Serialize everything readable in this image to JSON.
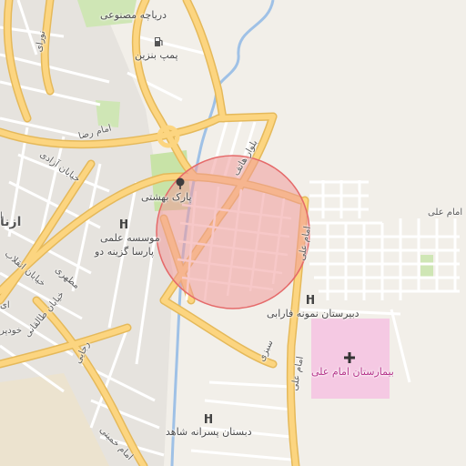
{
  "map": {
    "labels": {
      "lake": "دریاچه مصنوعی",
      "gas_station": "پمپ بنزین",
      "park": "پارک بهشتی",
      "street_hatef": "بلوار هاتف",
      "street_imam_reza": "امام رضا",
      "street_azadi": "خیابان آزادی",
      "street_enghelab": "خیابان انقلاب",
      "street_taleghani": "خیابان طالقانی",
      "street_motahari": "مطهری",
      "street_rajaei": "رجایی",
      "street_homeyni": "امام خمینی",
      "street_khodapour": "خودپر",
      "street_sabzi": "سبزی",
      "street_navvabi": "نورای",
      "street_imam_ali_1": "امام علی",
      "street_imam_ali_2": "امام علی",
      "street_imam_ali_3": "امام علی",
      "institute_1": "موسسه علمی",
      "institute_2": "پارسا گزینه دو",
      "school_farabi": "دبیرستان نمونه فارابی",
      "hospital": "بیمارستان امام علی",
      "school_shahed": "دبستان پسرانه شاهد",
      "city_fragment": "ازنا",
      "edge_fragment_1": "ا",
      "edge_fragment_2": "ای"
    },
    "icons": {
      "gas": "fuel-icon",
      "park": "tree-icon",
      "school": "school-icon",
      "hospital": "hospital-cross-icon"
    },
    "colors": {
      "background": "#f2efe9",
      "major_road": "#fcd580",
      "major_road_casing": "#e5b95a",
      "minor_road": "#ffffff",
      "river": "#9fc1e6",
      "park": "#c8e3a7",
      "hospital_area": "#f5c9e3",
      "highlight_fill": "#f19a9a",
      "highlight_stroke": "#e56a6a",
      "hospital_cross": "#333333"
    },
    "highlight": {
      "opacity": 0.55
    }
  }
}
